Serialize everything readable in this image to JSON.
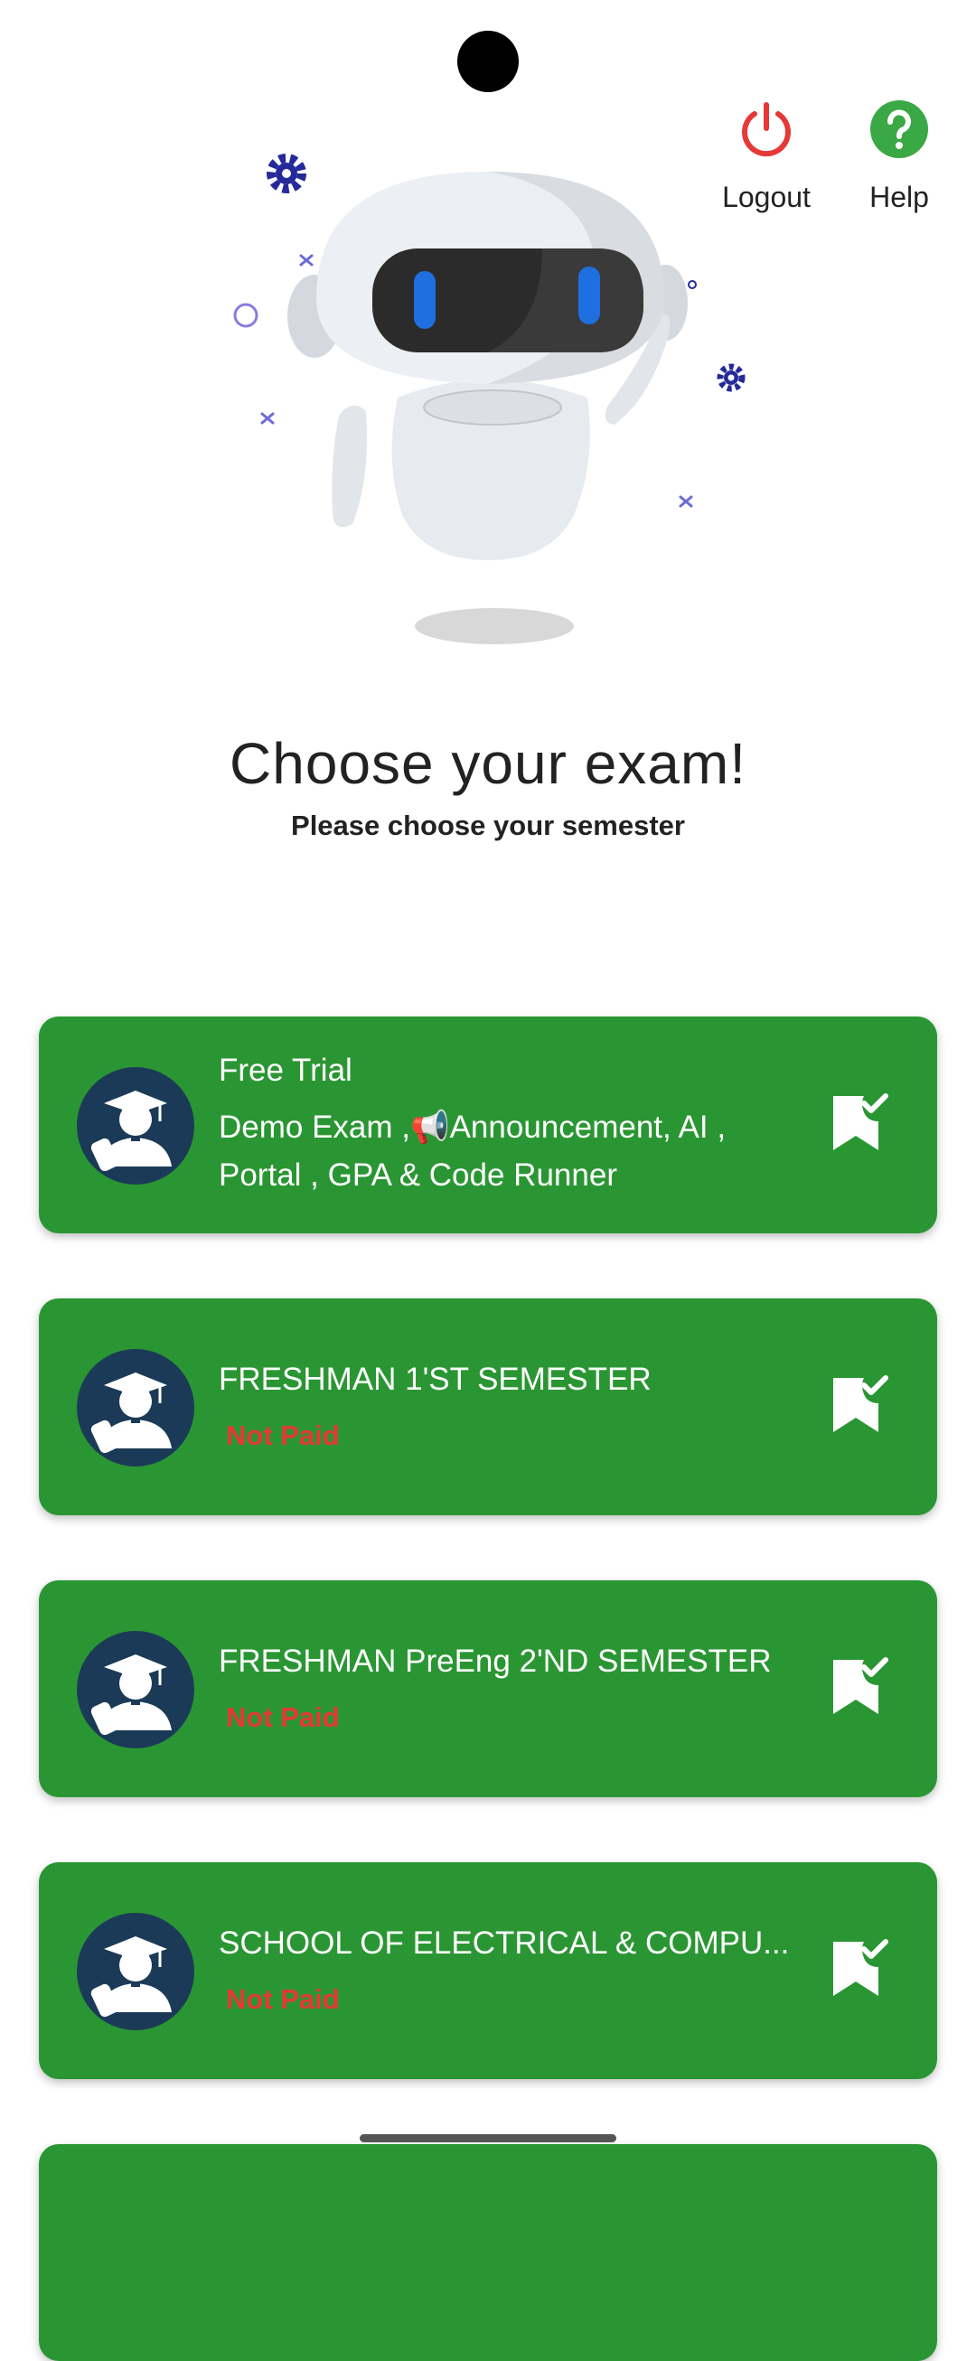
{
  "header": {
    "logout_label": "Logout",
    "help_label": "Help"
  },
  "intro": {
    "title": "Choose your exam!",
    "subtitle": "Please choose your semester"
  },
  "exams": [
    {
      "title": "Free Trial",
      "description": "Demo Exam ,📢Announcement, AI , Portal , GPA & Code Runner",
      "status": ""
    },
    {
      "title": "FRESHMAN 1'ST SEMESTER",
      "description": "",
      "status": "Not Paid"
    },
    {
      "title": "FRESHMAN PreEng 2'ND SEMESTER",
      "description": "",
      "status": "Not Paid"
    },
    {
      "title": "SCHOOL OF ELECTRICAL & COMPU...",
      "description": "",
      "status": "Not Paid"
    }
  ],
  "colors": {
    "card_green": "#2a9633",
    "logout_red": "#e53935",
    "help_green": "#3aa845",
    "status_red": "#e53935",
    "avatar_navy": "#1b3a57"
  }
}
